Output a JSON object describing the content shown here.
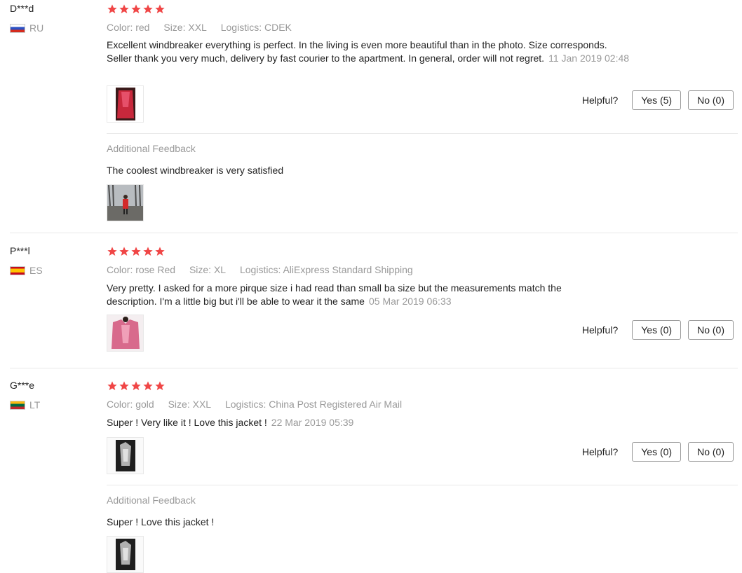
{
  "colors": {
    "star": "#f04646",
    "muted": "#999999",
    "text": "#222222"
  },
  "helpful_label": "Helpful?",
  "reviews": [
    {
      "user": "D***d",
      "country": "RU",
      "flag_icon": "russia-flag-icon",
      "rating": 5,
      "color": "Color: red",
      "size": "Size: XXL",
      "logistics": "Logistics: CDEK",
      "text_line1": "Excellent windbreaker everything is perfect. In the living is even more beautiful than in the photo. Size corresponds.",
      "text_line2": "Seller thank you very much, delivery by fast courier to the apartment. In general, order will not regret.",
      "date": "11 Jan 2019 02:48",
      "yes": "Yes (5)",
      "no": "No (0)",
      "additional_title": "Additional Feedback",
      "additional_text": "The coolest windbreaker is very satisfied"
    },
    {
      "user": "P***l",
      "country": "ES",
      "flag_icon": "spain-flag-icon",
      "rating": 5,
      "color": "Color: rose Red",
      "size": "Size: XL",
      "logistics": "Logistics: AliExpress Standard Shipping",
      "text_line1": "Very pretty. I asked for a more pirque size i had read than small ba size but the measurements match the",
      "text_line2": "description. I'm a little big but i'll be able to wear it the same",
      "date": "05 Mar 2019 06:33",
      "yes": "Yes (0)",
      "no": "No (0)"
    },
    {
      "user": "G***e",
      "country": "LT",
      "flag_icon": "lithuania-flag-icon",
      "rating": 5,
      "color": "Color: gold",
      "size": "Size: XXL",
      "logistics": "Logistics: China Post Registered Air Mail",
      "text_line1": "Super ! Very like it ! Love this jacket !",
      "date": "22 Mar 2019 05:39",
      "yes": "Yes (0)",
      "no": "No (0)",
      "additional_title": "Additional Feedback",
      "additional_text": "Super ! Love this jacket !"
    }
  ]
}
